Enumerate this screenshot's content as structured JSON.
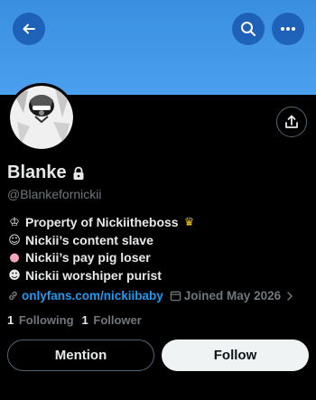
{
  "header": {
    "back_icon": "arrow-left-icon",
    "search_icon": "search-icon",
    "more_icon": "more-horizontal-icon",
    "banner_color": "#4aa0ee"
  },
  "profile": {
    "display_name": "Blanke",
    "protected_icon": "lock-icon",
    "handle": "@Blankefornickii",
    "bio_lines": [
      "Property of Nickiitheboss",
      "Nickii’s content slave",
      "Nickii’s pay pig loser",
      "Nickii worshiper purist"
    ],
    "link_text": "onlyfans.com/nickiibaby",
    "joined_text": "Joined May 2026",
    "following_count": "1",
    "following_label": "Following",
    "followers_count": "1",
    "followers_label": "Follower"
  },
  "actions": {
    "share_icon": "share-icon",
    "mention_label": "Mention",
    "follow_label": "Follow"
  },
  "colors": {
    "link": "#1d9bf0",
    "muted": "#71767b",
    "text": "#e7e9ea"
  }
}
